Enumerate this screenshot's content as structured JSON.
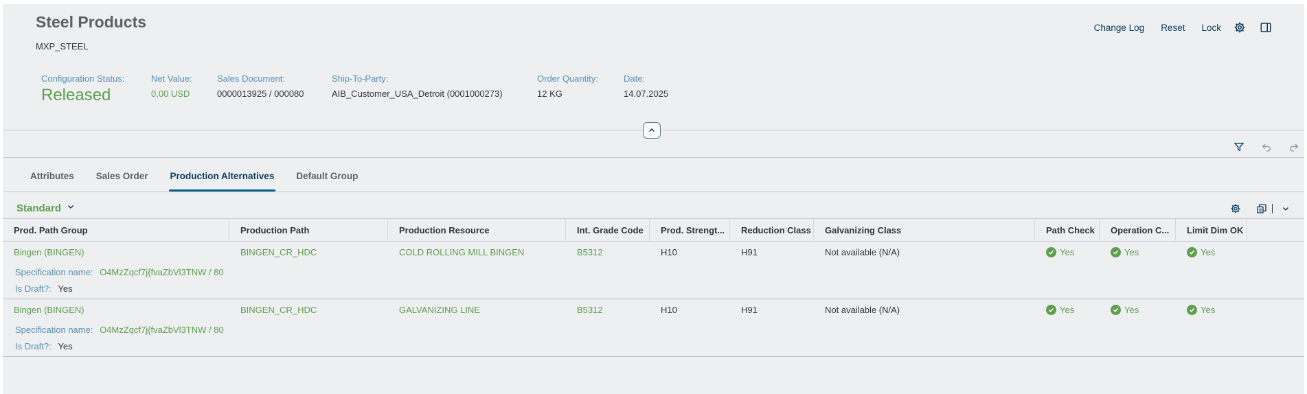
{
  "header": {
    "title": "Steel Products",
    "subtitle": "MXP_STEEL",
    "actions": [
      "Change Log",
      "Reset",
      "Lock"
    ],
    "icons": [
      "settings-icon",
      "side-panel-icon"
    ]
  },
  "kpis": {
    "config_status_label": "Configuration Status:",
    "config_status_value": "Released",
    "net_value_label": "Net Value:",
    "net_value_value": "0,00 USD",
    "sales_doc_label": "Sales Document:",
    "sales_doc_value": "0000013925 / 000080",
    "ship_to_label": "Ship-To-Party:",
    "ship_to_value": "AIB_Customer_USA_Detroit (0001000273)",
    "order_qty_label": "Order Quantity:",
    "order_qty_value": "12 KG",
    "date_label": "Date:",
    "date_value": "14.07.2025"
  },
  "toolbar_icons": [
    "filter-icon",
    "undo-icon",
    "redo-icon"
  ],
  "tabs": [
    {
      "label": "Attributes",
      "active": false
    },
    {
      "label": "Sales Order",
      "active": false
    },
    {
      "label": "Production Alternatives",
      "active": true
    },
    {
      "label": "Default Group",
      "active": false
    }
  ],
  "variant": {
    "label": "Standard"
  },
  "table": {
    "columns": [
      "Prod. Path Group",
      "Production Path",
      "Production Resource",
      "Int. Grade Code",
      "Prod. Strengt...",
      "Reduction Class",
      "Galvanizing Class",
      "Path Check",
      "Operation C...",
      "Limit Dim OK"
    ],
    "rows": [
      {
        "prod_path_group": "Bingen (BINGEN)",
        "production_path": "BINGEN_CR_HDC",
        "production_resource": "COLD ROLLING MILL BINGEN",
        "int_grade_code": "B5312",
        "prod_strength": "H10",
        "reduction_class": "H91",
        "galvanizing_class": "Not available (N/A)",
        "path_check": "Yes",
        "operation_check": "Yes",
        "limit_dim_ok": "Yes",
        "spec_label": "Specification name:",
        "spec_value": "O4MzZqcf7j{fvaZbVl3TNW / 80",
        "draft_label": "Is Draft?:",
        "draft_value": "Yes"
      },
      {
        "prod_path_group": "Bingen (BINGEN)",
        "production_path": "BINGEN_CR_HDC",
        "production_resource": "GALVANIZING LINE",
        "int_grade_code": "B5312",
        "prod_strength": "H10",
        "reduction_class": "H91",
        "galvanizing_class": "Not available (N/A)",
        "path_check": "Yes",
        "operation_check": "Yes",
        "limit_dim_ok": "Yes",
        "spec_label": "Specification name:",
        "spec_value": "O4MzZqcf7j{fvaZbVl3TNW / 80",
        "draft_label": "Is Draft?:",
        "draft_value": "Yes"
      }
    ]
  },
  "colors": {
    "accent_green": "#5e9e4f",
    "label_blue": "#5b8fb1",
    "dark_blue": "#0a3b5c",
    "background": "#edeff0"
  }
}
